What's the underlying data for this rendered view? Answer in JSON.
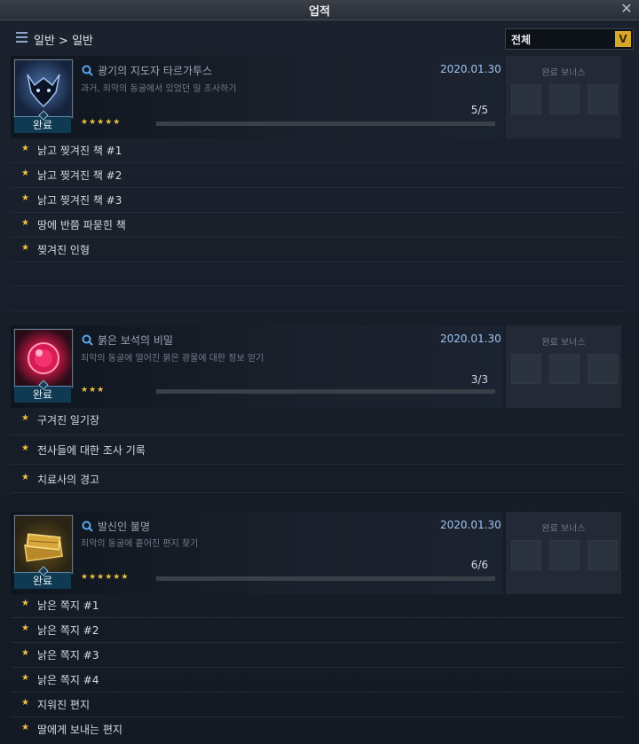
{
  "window": {
    "title": "업적",
    "close_label": "✕"
  },
  "toolbar": {
    "breadcrumb": "일반 > 일반",
    "filter_value": "전체",
    "filter_arrow": "V"
  },
  "bonus_label": "완료 보너스",
  "done_label": "완료",
  "achievements": [
    {
      "title": "광기의 지도자 타르가투스",
      "description": "과거, 죄악의 동굴에서 있었던 일 조사하기",
      "date": "2020.01.30",
      "stars": "★★★★★",
      "progress_text": "5/5",
      "progress": 1.0,
      "items": [
        "낡고 찢겨진 책 #1",
        "낡고 찢겨진 책 #2",
        "낡고 찢겨진 책 #3",
        "땅에 반쯤 파묻힌 책",
        "찢겨진 인형"
      ]
    },
    {
      "title": "붉은 보석의 비밀",
      "description": "죄악의 동굴에 떨어진 붉은 광물에 대한 정보 얻기",
      "date": "2020.01.30",
      "stars": "★★★",
      "progress_text": "3/3",
      "progress": 1.0,
      "items": [
        "구겨진 일기장",
        "전사들에 대한 조사 기록",
        "치료사의 경고"
      ]
    },
    {
      "title": "발신인 불명",
      "description": "죄악의 동굴에 흩어진 편지 찾기",
      "date": "2020.01.30",
      "stars": "★★★★★★",
      "progress_text": "6/6",
      "progress": 1.0,
      "items": [
        "낡은 쪽지 #1",
        "낡은 쪽지 #2",
        "낡은 쪽지 #3",
        "낡은 쪽지 #4",
        "지워진 편지",
        "딸에게 보내는 편지"
      ]
    }
  ],
  "colors": {
    "accent": "#d9a72a",
    "date": "#9fc3ee",
    "star": "#f0c040"
  }
}
